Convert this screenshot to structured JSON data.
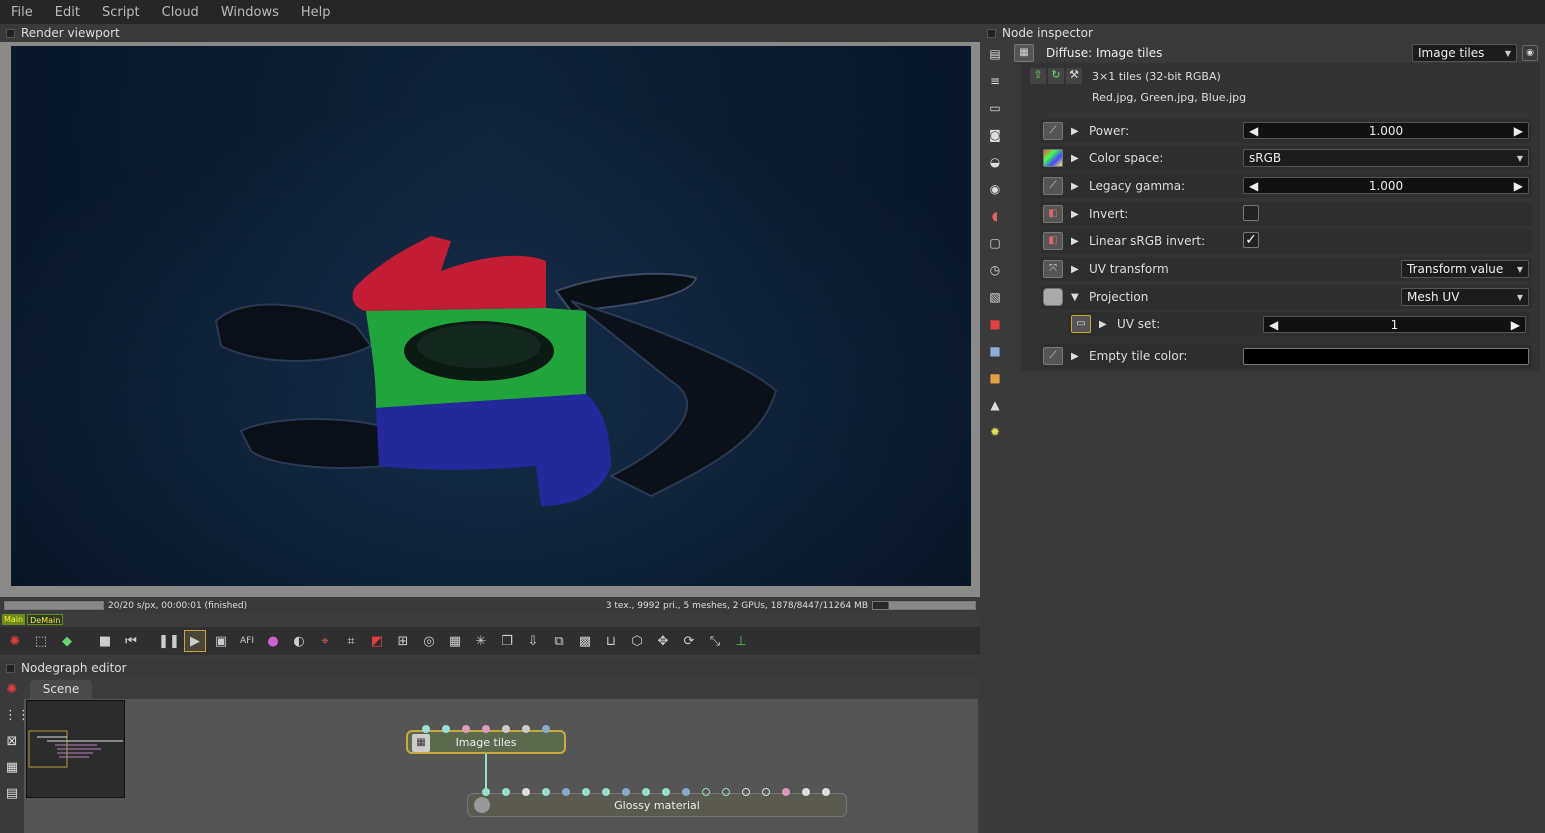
{
  "menu": [
    "File",
    "Edit",
    "Script",
    "Cloud",
    "Windows",
    "Help"
  ],
  "render_viewport": {
    "title": "Render viewport",
    "status_left": "20/20 s/px, 00:00:01 (finished)",
    "status_right": "3 tex., 9992 pri., 5 meshes, 2 GPUs, 1878/8447/11264 MB",
    "mini_tabs": [
      "Main",
      "DeMain"
    ]
  },
  "nodegraph": {
    "title": "Nodegraph editor",
    "tab": "Scene",
    "nodes": {
      "image_tiles": "Image tiles",
      "glossy_material": "Glossy material"
    }
  },
  "inspector": {
    "title": "Node inspector",
    "node_name": "Diffuse: Image tiles",
    "node_type": "Image tiles",
    "file_info": "3×1 tiles (32-bit RGBA)",
    "file_names": "Red.jpg, Green.jpg, Blue.jpg",
    "params": {
      "power_label": "Power:",
      "power_value": "1.000",
      "colorspace_label": "Color space:",
      "colorspace_value": "sRGB",
      "gamma_label": "Legacy gamma:",
      "gamma_value": "1.000",
      "invert_label": "Invert:",
      "linear_invert_label": "Linear sRGB invert:",
      "linear_invert_mark": "✓",
      "uv_transform_label": "UV transform",
      "uv_transform_value": "Transform value",
      "projection_label": "Projection",
      "projection_value": "Mesh UV",
      "uvset_label": "UV set:",
      "uvset_value": "1",
      "empty_tile_label": "Empty tile color:"
    },
    "empty_tile_color": "#000000"
  }
}
